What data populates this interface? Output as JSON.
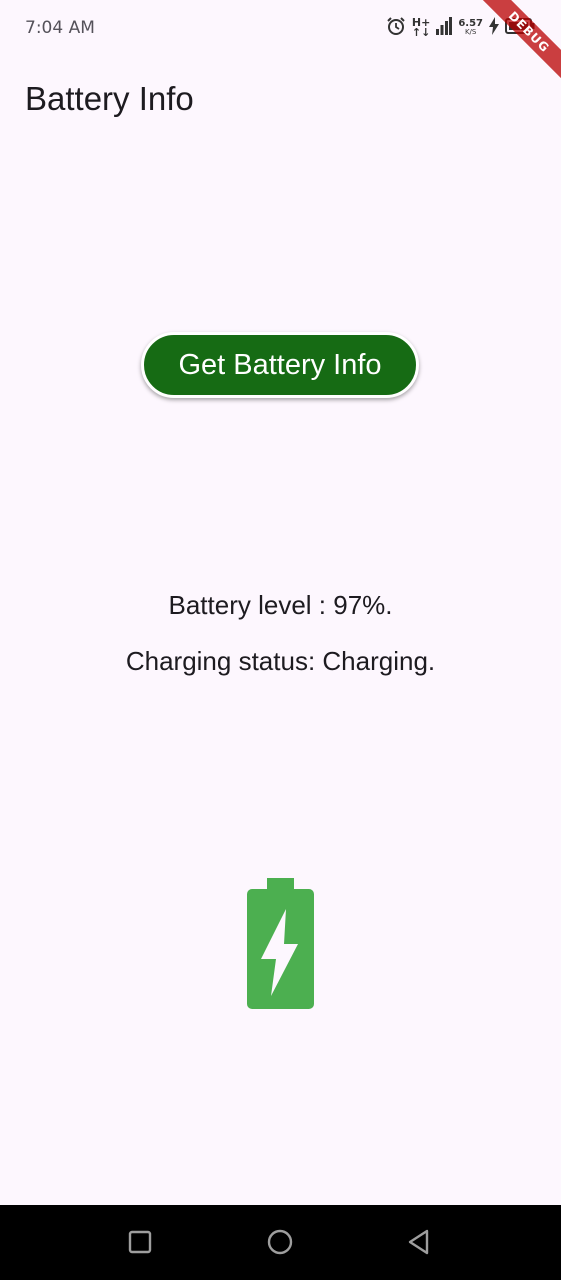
{
  "status_bar": {
    "time": "7:04 AM",
    "network_type_top": "H+",
    "network_type_bottom": "↑↓",
    "speed_value": "6.57",
    "speed_unit": "K/S",
    "icons": [
      "alarm-icon",
      "network-type-icon",
      "signal-icon",
      "network-speed-icon",
      "charging-bolt-icon",
      "battery-icon"
    ]
  },
  "debug_banner": {
    "label": "DEBUG"
  },
  "app_bar": {
    "title": "Battery Info"
  },
  "actions": {
    "get_battery_info_label": "Get Battery Info"
  },
  "battery": {
    "level_text": "Battery level : 97%.",
    "status_text": "Charging status: Charging.",
    "level_percent": 97,
    "icon": "battery-charging-icon"
  },
  "nav_bar": {
    "buttons": [
      "recent-apps-icon",
      "home-icon",
      "back-icon"
    ]
  },
  "colors": {
    "background": "#fdf7fe",
    "button_background": "#166b14",
    "button_text": "#ffffff",
    "battery_icon": "#4caf50",
    "nav_bar": "#000000",
    "debug_banner": "#b80000"
  }
}
